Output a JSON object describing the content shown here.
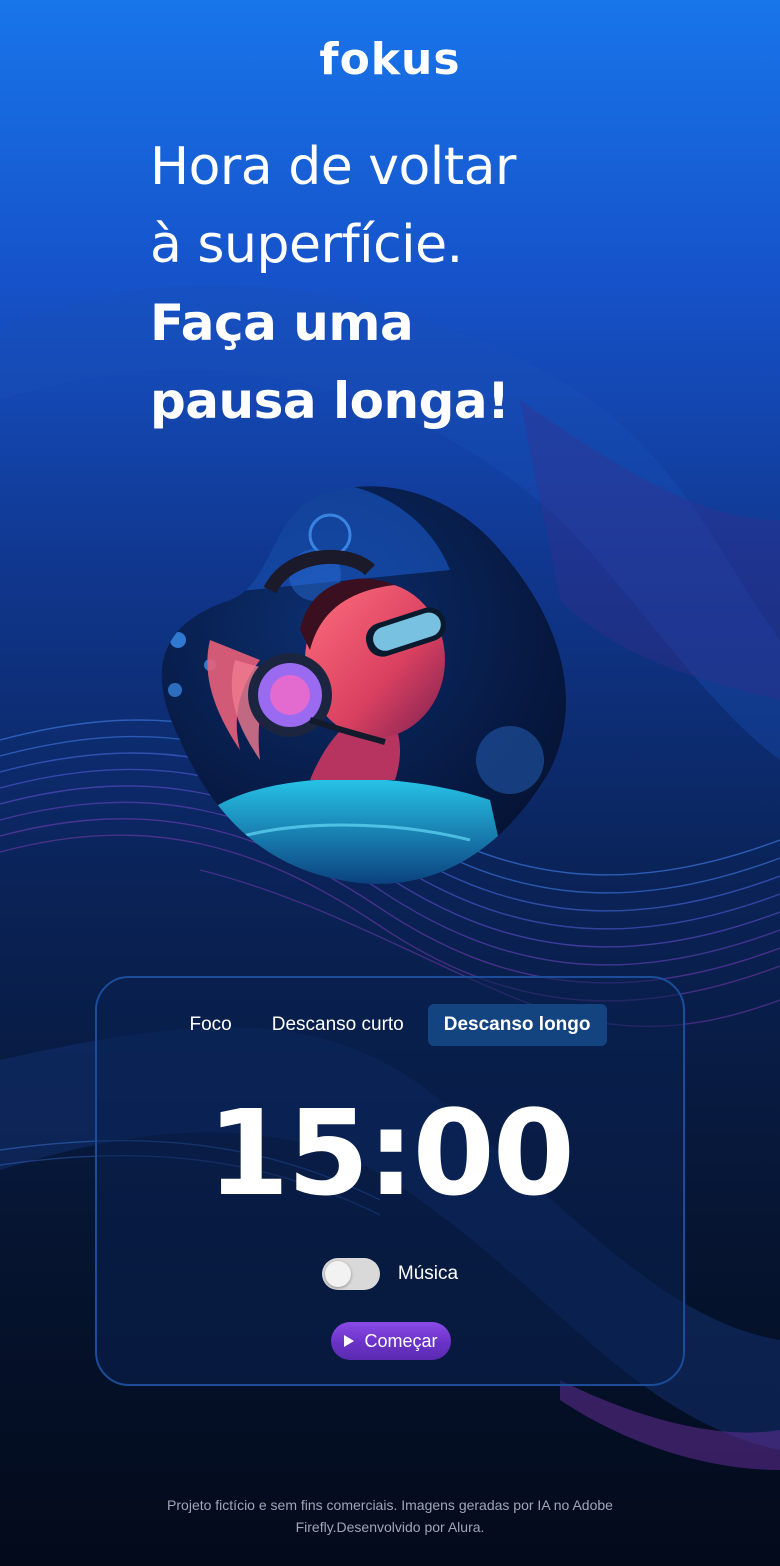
{
  "brand": {
    "logo": "fokus"
  },
  "headline": {
    "line1": "Hora de voltar",
    "line2": "à superfície.",
    "line3": "Faça uma",
    "line4": "pausa longa!"
  },
  "hero": {
    "icon": "diver-with-headphones-image"
  },
  "timer_card": {
    "tabs": [
      {
        "label": "Foco",
        "active": false
      },
      {
        "label": "Descanso curto",
        "active": false
      },
      {
        "label": "Descanso longo",
        "active": true
      }
    ],
    "time": "15:00",
    "music": {
      "label": "Música",
      "enabled": false
    },
    "start_button": {
      "label": "Começar",
      "icon": "play-icon"
    }
  },
  "footer": {
    "text_line1": "Projeto fictício e sem fins comerciais. Imagens geradas por IA no Adobe",
    "text_line2": "Firefly.Desenvolvido por Alura."
  },
  "colors": {
    "accent": "#144480",
    "button": "#7a3fdc",
    "card_border": "#1b4d9a"
  }
}
